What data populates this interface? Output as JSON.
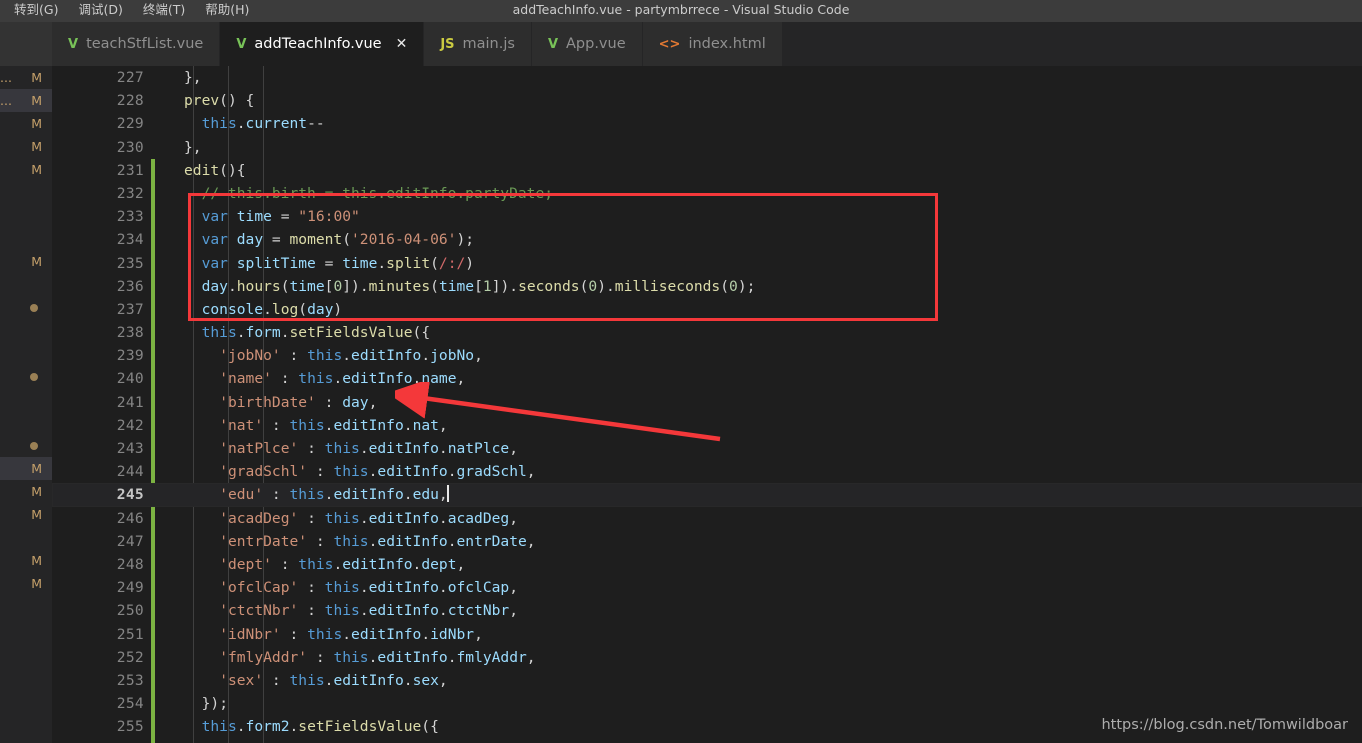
{
  "window": {
    "title": "addTeachInfo.vue - partymbrrece - Visual Studio Code",
    "menu": [
      {
        "label": "转到(G)"
      },
      {
        "label": "调试(D)"
      },
      {
        "label": "终端(T)"
      },
      {
        "label": "帮助(H)"
      }
    ]
  },
  "tabs": [
    {
      "label": "teachStfList.vue",
      "icon": "vue-file-icon",
      "icon_glyph": "V",
      "icon_type": "vue",
      "active": false,
      "close": ""
    },
    {
      "label": "addTeachInfo.vue",
      "icon": "vue-file-icon",
      "icon_glyph": "V",
      "icon_type": "vue",
      "active": true,
      "close": "✕"
    },
    {
      "label": "main.js",
      "icon": "js-file-icon",
      "icon_glyph": "JS",
      "icon_type": "js",
      "active": false,
      "close": ""
    },
    {
      "label": "App.vue",
      "icon": "vue-file-icon",
      "icon_glyph": "V",
      "icon_type": "vue",
      "active": false,
      "close": ""
    },
    {
      "label": "index.html",
      "icon": "html-file-icon",
      "icon_glyph": "<>",
      "icon_type": "html",
      "active": false,
      "close": ""
    }
  ],
  "sidepane": {
    "rows": [
      {
        "prefix": "...",
        "badge": "M",
        "selected": false
      },
      {
        "prefix": "...",
        "badge": "M",
        "selected": true
      },
      {
        "prefix": "",
        "badge": "M",
        "selected": false
      },
      {
        "prefix": "",
        "badge": "M",
        "selected": false
      },
      {
        "prefix": "",
        "badge": "M",
        "selected": false
      },
      {
        "prefix": "",
        "badge": "",
        "selected": false
      },
      {
        "prefix": "",
        "badge": "",
        "selected": false
      },
      {
        "prefix": "",
        "badge": "",
        "selected": false
      },
      {
        "prefix": "",
        "badge": "M",
        "selected": false
      },
      {
        "prefix": "",
        "badge": "",
        "selected": false
      },
      {
        "prefix": "",
        "badge": "•",
        "selected": false
      },
      {
        "prefix": "",
        "badge": "",
        "selected": false
      },
      {
        "prefix": "",
        "badge": "",
        "selected": false
      },
      {
        "prefix": "",
        "badge": "•",
        "selected": false
      },
      {
        "prefix": "",
        "badge": "",
        "selected": false
      },
      {
        "prefix": "",
        "badge": "",
        "selected": false
      },
      {
        "prefix": "",
        "badge": "•",
        "selected": false
      },
      {
        "prefix": "",
        "badge": "M",
        "selected": true
      },
      {
        "prefix": "",
        "badge": "M",
        "selected": false
      },
      {
        "prefix": "",
        "badge": "M",
        "selected": false
      },
      {
        "prefix": "",
        "badge": "",
        "selected": false
      },
      {
        "prefix": "",
        "badge": "M",
        "selected": false
      },
      {
        "prefix": "",
        "badge": "M",
        "selected": false
      }
    ]
  },
  "editor": {
    "active_line": 245,
    "first_line": 227,
    "git_change_from_line": 231,
    "lines": [
      {
        "n": 227,
        "text": "    },",
        "indent": 2
      },
      {
        "n": 228,
        "text": "    prev() {",
        "indent": 2
      },
      {
        "n": 229,
        "text": "      this.current--",
        "indent": 3
      },
      {
        "n": 230,
        "text": "    },",
        "indent": 2
      },
      {
        "n": 231,
        "text": "    edit(){",
        "indent": 2
      },
      {
        "n": 232,
        "text": "      // this.birth = this.editInfo.partyDate;",
        "indent": 3
      },
      {
        "n": 233,
        "text": "      var time = \"16:00\"",
        "indent": 3
      },
      {
        "n": 234,
        "text": "      var day = moment('2016-04-06');",
        "indent": 3
      },
      {
        "n": 235,
        "text": "      var splitTime = time.split(/:/)",
        "indent": 3
      },
      {
        "n": 236,
        "text": "      day.hours(time[0]).minutes(time[1]).seconds(0).milliseconds(0);",
        "indent": 3
      },
      {
        "n": 237,
        "text": "      console.log(day)",
        "indent": 3
      },
      {
        "n": 238,
        "text": "      this.form.setFieldsValue({",
        "indent": 3
      },
      {
        "n": 239,
        "text": "        'jobNo' : this.editInfo.jobNo,",
        "indent": 4
      },
      {
        "n": 240,
        "text": "        'name' : this.editInfo.name,",
        "indent": 4
      },
      {
        "n": 241,
        "text": "        'birthDate' : day,",
        "indent": 4
      },
      {
        "n": 242,
        "text": "        'nat' : this.editInfo.nat,",
        "indent": 4
      },
      {
        "n": 243,
        "text": "        'natPlce' : this.editInfo.natPlce,",
        "indent": 4
      },
      {
        "n": 244,
        "text": "        'gradSchl' : this.editInfo.gradSchl,",
        "indent": 4
      },
      {
        "n": 245,
        "text": "        'edu' : this.editInfo.edu,",
        "indent": 4
      },
      {
        "n": 246,
        "text": "        'acadDeg' : this.editInfo.acadDeg,",
        "indent": 4
      },
      {
        "n": 247,
        "text": "        'entrDate' : this.editInfo.entrDate,",
        "indent": 4
      },
      {
        "n": 248,
        "text": "        'dept' : this.editInfo.dept,",
        "indent": 4
      },
      {
        "n": 249,
        "text": "        'ofclCap' : this.editInfo.ofclCap,",
        "indent": 4
      },
      {
        "n": 250,
        "text": "        'ctctNbr' : this.editInfo.ctctNbr,",
        "indent": 4
      },
      {
        "n": 251,
        "text": "        'idNbr' : this.editInfo.idNbr,",
        "indent": 4
      },
      {
        "n": 252,
        "text": "        'fmlyAddr' : this.editInfo.fmlyAddr,",
        "indent": 4
      },
      {
        "n": 253,
        "text": "        'sex' : this.editInfo.sex,",
        "indent": 4
      },
      {
        "n": 254,
        "text": "      });",
        "indent": 3
      },
      {
        "n": 255,
        "text": "      this.form2.setFieldsValue({",
        "indent": 3
      }
    ]
  },
  "annotations": {
    "highlight_box": {
      "color": "#f4383a",
      "from_line": 233,
      "to_line": 237
    },
    "arrow": {
      "color": "#f4383a",
      "points_at_line": 241,
      "points_at_token": "day,"
    }
  },
  "watermark": {
    "text": "https://blog.csdn.net/Tomwildboar"
  },
  "colors": {
    "background": "#1e1e1e",
    "tabbar": "#252526",
    "titlebar": "#3c3c3c",
    "keyword": "#569cd6",
    "variable": "#9cdcfe",
    "string": "#ce9178",
    "comment": "#6a9955",
    "function": "#dcdcaa",
    "number": "#b5cea8",
    "git_added": "#7cb342",
    "annotation_red": "#f4383a"
  }
}
